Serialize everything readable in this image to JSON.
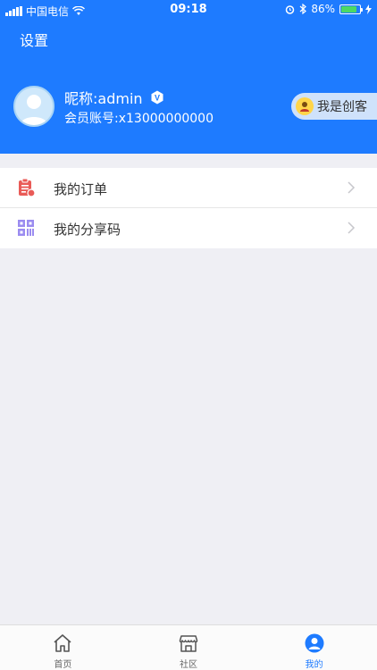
{
  "status_bar": {
    "carrier": "中国电信",
    "time": "09:18",
    "battery_percent": "86%",
    "battery_level": 0.86
  },
  "header": {
    "settings_label": "设置",
    "nickname": "昵称:admin",
    "account": "会员账号:x13000000000",
    "creator_label": "我是创客",
    "verified_badge_letter": "V"
  },
  "menu": {
    "orders_label": "我的订单",
    "share_code_label": "我的分享码"
  },
  "tabbar": {
    "home_label": "首页",
    "community_label": "社区",
    "mine_label": "我的"
  },
  "colors": {
    "primary": "#1e7bff",
    "background": "#efeff4",
    "order_icon": "#e95b57",
    "qr_icon": "#9b8cf0"
  }
}
